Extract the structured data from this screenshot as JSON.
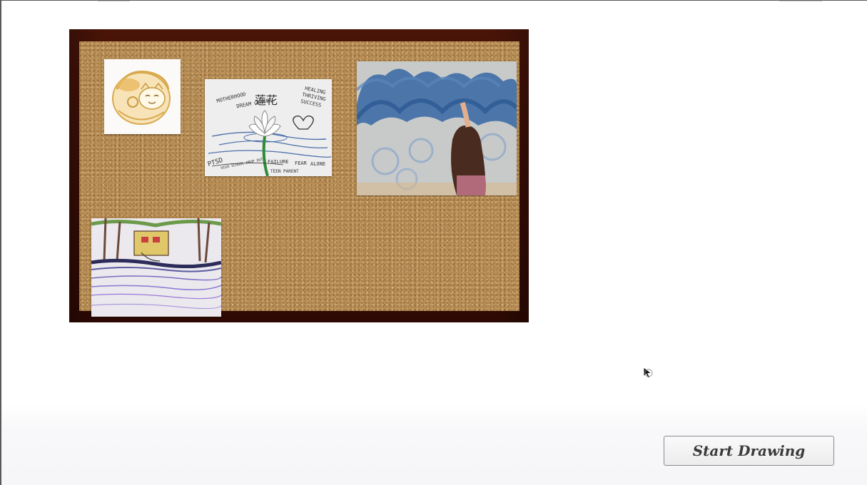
{
  "board": {
    "cards": [
      {
        "name": "cat-sticker"
      },
      {
        "name": "lotus-drawing",
        "texts": {
          "motherhood": "MOTHERHOOD",
          "dream_career": "DREAM CAREER",
          "lotus_chars": "莲花",
          "healing": "HEALING",
          "thriving": "THRIVING",
          "success": "SUCCESS",
          "ptsd": "PTSD",
          "hs_dropout": "HIGH SCHOOL DROP OUT",
          "failure": "FAILURE",
          "fear": "FEAR",
          "alone": "ALONE",
          "teen_parent": "TEEN PARENT"
        }
      },
      {
        "name": "chalk-waves-photo"
      },
      {
        "name": "lake-sketch"
      }
    ]
  },
  "actions": {
    "start_drawing_label": "Start Drawing"
  },
  "colors": {
    "frame": "#3a0d05",
    "cork": "#b78d55",
    "button_border": "#8b8b8b"
  },
  "icons": {
    "cursor": "arrow-cursor-icon"
  }
}
